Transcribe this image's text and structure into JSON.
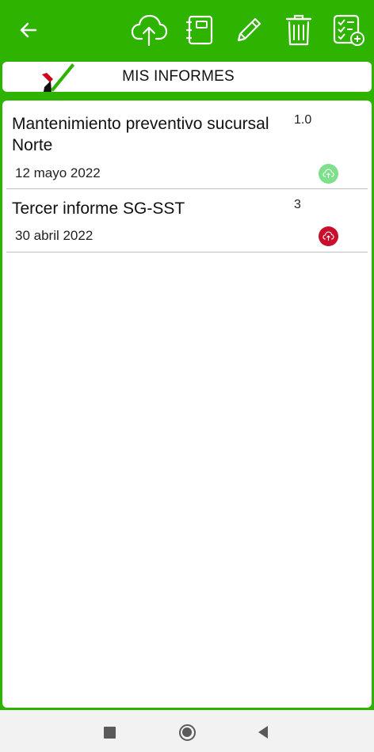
{
  "app": {
    "header_color": "#2db300",
    "title": "MIS INFORMES"
  },
  "toolbar": {
    "icons": [
      "back-arrow-icon",
      "cloud-upload-icon",
      "notebook-icon",
      "pencil-icon",
      "trash-icon",
      "checklist-add-icon"
    ]
  },
  "reports": [
    {
      "name": "Mantenimiento preventivo sucursal Norte",
      "version": "1.0",
      "date": "12 mayo 2022",
      "sync_status_color": "#7ee08a"
    },
    {
      "name": "Tercer informe SG-SST",
      "version": "3",
      "date": "30 abril 2022",
      "sync_status_color": "#c8102e"
    }
  ],
  "navbar": {
    "icons": [
      "recents-square-icon",
      "home-circle-icon",
      "back-triangle-icon"
    ]
  }
}
